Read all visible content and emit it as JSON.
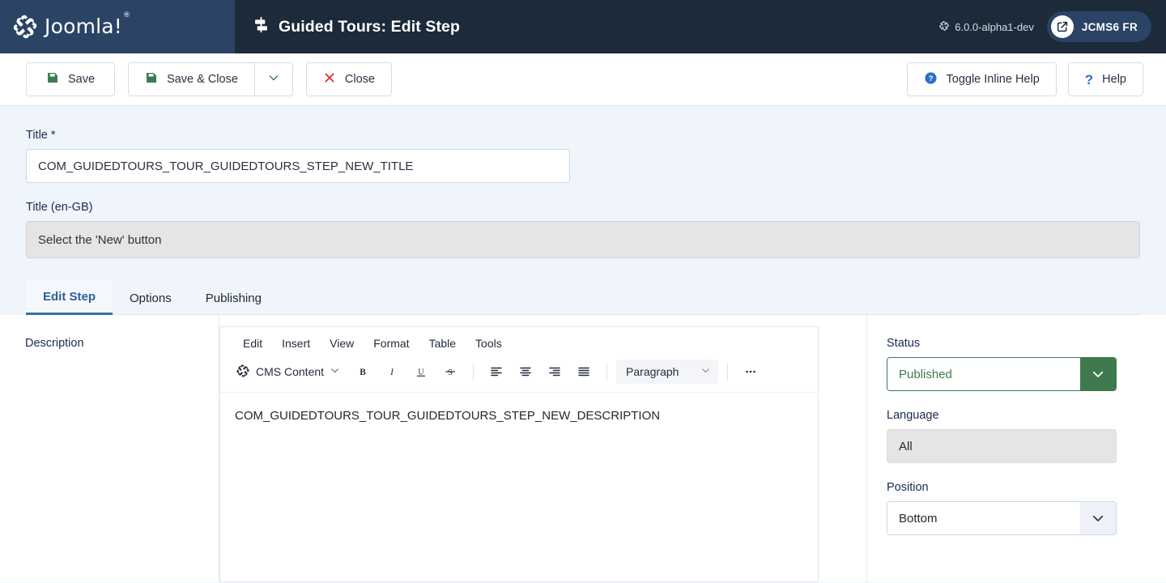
{
  "header": {
    "brand": "Joomla!",
    "brand_trademark": "®",
    "title": "Guided Tours: Edit Step",
    "title_icon": "signpost-icon",
    "version": "6.0.0-alpha1-dev",
    "version_icon": "joomla-icon",
    "site_pill_label": "JCMS6 FR",
    "site_pill_icon": "external-link-icon",
    "colors": {
      "logo_zone": "#2b4365",
      "title_zone": "#1c2a3a",
      "pill": "#2b4365"
    }
  },
  "toolbar": {
    "save_label": "Save",
    "save_icon": "floppy-disk-icon",
    "save_close_label": "Save & Close",
    "save_close_icon": "floppy-disk-icon",
    "dropdown_icon": "chevron-down-icon",
    "close_label": "Close",
    "close_icon": "x-icon",
    "toggle_inline_help_label": "Toggle Inline Help",
    "toggle_inline_help_icon": "question-circle-icon",
    "help_label": "Help",
    "help_icon": "question-mark-icon",
    "colors": {
      "save_icon": "#3e7a4e",
      "close_icon": "#d9342b",
      "help_icon": "#2a6fc9"
    }
  },
  "form": {
    "title_label": "Title *",
    "title_value": "COM_GUIDEDTOURS_TOUR_GUIDEDTOURS_STEP_NEW_TITLE",
    "title_placeholder": "",
    "title_engb_label": "Title (en-GB)",
    "title_engb_value": "Select the 'New' button",
    "title_engb_placeholder": ""
  },
  "tabs": [
    {
      "label": "Edit Step",
      "active": true
    },
    {
      "label": "Options",
      "active": false
    },
    {
      "label": "Publishing",
      "active": false
    }
  ],
  "editor": {
    "field_label": "Description",
    "menubar": [
      "Edit",
      "Insert",
      "View",
      "Format",
      "Table",
      "Tools"
    ],
    "cms_content_label": "CMS Content",
    "cms_content_icon": "joomla-icon",
    "cms_caret_icon": "chevron-down-icon",
    "bold_icon": "bold-icon",
    "italic_icon": "italic-icon",
    "underline_icon": "underline-icon",
    "strikethrough_icon": "strikethrough-icon",
    "align_left_icon": "align-left-icon",
    "align_center_icon": "align-center-icon",
    "align_right_icon": "align-right-icon",
    "align_justify_icon": "align-justify-icon",
    "format_select_value": "Paragraph",
    "format_caret_icon": "chevron-down-icon",
    "more_icon": "ellipsis-icon",
    "content": "COM_GUIDEDTOURS_TOUR_GUIDEDTOURS_STEP_NEW_DESCRIPTION"
  },
  "sidebar": {
    "status_label": "Status",
    "status_value": "Published",
    "status_caret_icon": "chevron-down-icon",
    "status_color": "#3e7a4e",
    "language_label": "Language",
    "language_value": "All",
    "position_label": "Position",
    "position_value": "Bottom",
    "position_caret_icon": "chevron-down-icon"
  }
}
